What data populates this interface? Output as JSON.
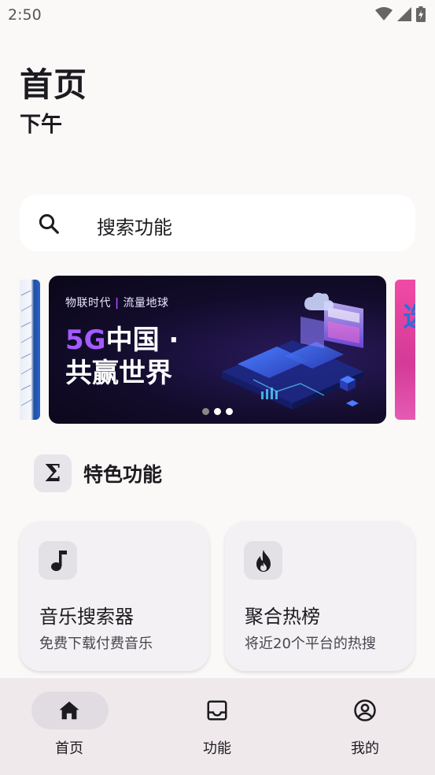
{
  "status_bar": {
    "time": "2:50"
  },
  "header": {
    "title": "首页",
    "subtitle": "下午"
  },
  "search": {
    "label": "搜索功能",
    "icon": "search-icon"
  },
  "banner": {
    "kicker_left": "物联时代",
    "kicker_right": "流量地球",
    "line1_accent": "5G",
    "line1_rest": "中国 ·",
    "line2": "共赢世界",
    "side_right_glyph": "选",
    "dots_total": 3,
    "dots_active_index": 1
  },
  "section": {
    "icon": "sigma-icon",
    "icon_glyph": "Σ",
    "title": "特色功能"
  },
  "features": [
    {
      "title": "音乐搜索器",
      "desc": "免费下载付费音乐",
      "icon": "music-note-icon"
    },
    {
      "title": "聚合热榜",
      "desc": "将近20个平台的热搜",
      "icon": "fire-icon"
    }
  ],
  "bottom_nav": {
    "items": [
      {
        "label": "首页",
        "icon": "home-icon",
        "active": true
      },
      {
        "label": "功能",
        "icon": "inbox-icon",
        "active": false
      },
      {
        "label": "我的",
        "icon": "account-circle-icon",
        "active": false
      }
    ]
  },
  "colors": {
    "background": "#fbf8f8",
    "banner_accent": "#a35bff",
    "nav_background": "#efe9ec"
  }
}
